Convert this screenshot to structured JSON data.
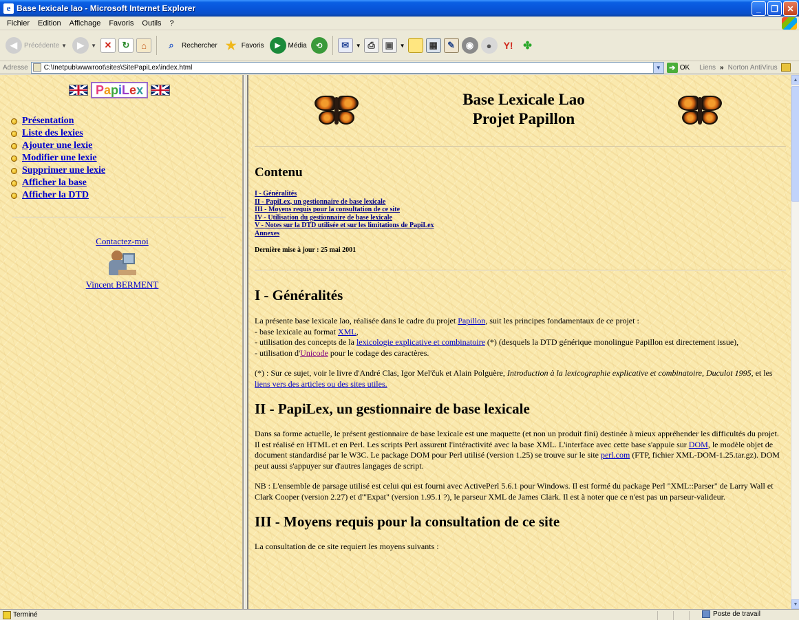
{
  "window": {
    "title": "Base lexicale lao - Microsoft Internet Explorer"
  },
  "menubar": {
    "items": [
      "Fichier",
      "Edition",
      "Affichage",
      "Favoris",
      "Outils",
      "?"
    ]
  },
  "toolbar": {
    "back": "Précédente",
    "search": "Rechercher",
    "favorites": "Favoris",
    "media": "Média"
  },
  "addressbar": {
    "label": "Adresse",
    "url": "C:\\Inetpub\\wwwroot\\sites\\SitePapiLex\\index.html",
    "go": "OK",
    "links": "Liens",
    "chevron": "»",
    "norton": "Norton AntiVirus"
  },
  "left": {
    "logo": [
      "P",
      "a",
      "p",
      "i",
      "L",
      "e",
      "x"
    ],
    "menu": [
      "Présentation",
      "Liste des lexies",
      "Ajouter une lexie",
      "Modifier une lexie",
      "Supprimer une lexie",
      "Afficher la base",
      "Afficher la DTD"
    ],
    "contact_link": "Contactez-moi",
    "author": "Vincent BERMENT"
  },
  "right": {
    "title_line1": "Base Lexicale Lao",
    "title_line2": "Projet Papillon",
    "contents_heading": "Contenu",
    "toc": [
      "I - Généralités",
      "II - PapiLex, un gestionnaire de base lexicale",
      "III - Moyens requis pour la consultation de ce site",
      "IV - Utilisation du gestionnaire de base lexicale",
      "V - Notes sur la DTD utilisée et sur les limitations de PapiLex",
      "Annexes"
    ],
    "last_update": "Dernière mise à jour : 25 mai 2001",
    "s1": {
      "heading": "I - Généralités",
      "intro_a": "La présente base lexicale lao, réalisée dans le cadre du projet ",
      "link_papillon": "Papillon",
      "intro_b": ", suit les principes fondamentaux de ce projet :",
      "b1_a": "- base lexicale au format ",
      "link_xml": "XML",
      "b1_b": ",",
      "b2_a": "- utilisation des concepts de la ",
      "link_lec": "lexicologie explicative et combinatoire",
      "b2_b": " (*) (desquels la DTD générique monolingue Papillon est directement issue),",
      "b3_a": "- utilisation d'",
      "link_unicode": "Unicode",
      "b3_b": " pour le codage des caractères.",
      "note_a": "(*) : Sur ce sujet, voir le livre d'André Clas, Igor Mel'čuk et Alain Polguère, ",
      "note_book": "Introduction à la lexicographie explicative et combinatoire, Duculot 1995",
      "note_b": ", et les ",
      "link_liens": "liens vers des articles ou des sites utiles."
    },
    "s2": {
      "heading": "II - PapiLex, un gestionnaire de base lexicale",
      "p1_a": "Dans sa forme actuelle, le présent gestionnaire de base lexicale est une maquette (et non un produit fini) destinée à mieux appréhender les difficultés du projet. Il est réalisé en HTML et en Perl. Les scripts Perl assurent l'intéractivité avec la base XML. L'interface avec cette base s'appuie sur ",
      "link_dom": "DOM",
      "p1_b": ", le modèle objet de document standardisé par le W3C. Le package DOM pour Perl utilisé (version 1.25) se trouve sur le site ",
      "link_perl": "perl.com",
      "p1_c": " (FTP, fichier XML-DOM-1.25.tar.gz). DOM peut aussi s'appuyer sur d'autres langages de script.",
      "p2": "NB : L'ensemble de parsage utilisé est celui qui est fourni avec ActivePerl 5.6.1 pour Windows. Il est formé du package Perl \"XML::Parser\" de Larry Wall et Clark Cooper (version 2.27) et d'\"Expat\" (version 1.95.1 ?), le parseur XML de James Clark. Il est à noter que ce n'est pas un parseur-valideur."
    },
    "s3": {
      "heading": "III - Moyens requis pour la consultation de ce site",
      "p1": "La consultation de ce site requiert les moyens suivants :"
    }
  },
  "statusbar": {
    "status": "Terminé",
    "zone": "Poste de travail"
  }
}
